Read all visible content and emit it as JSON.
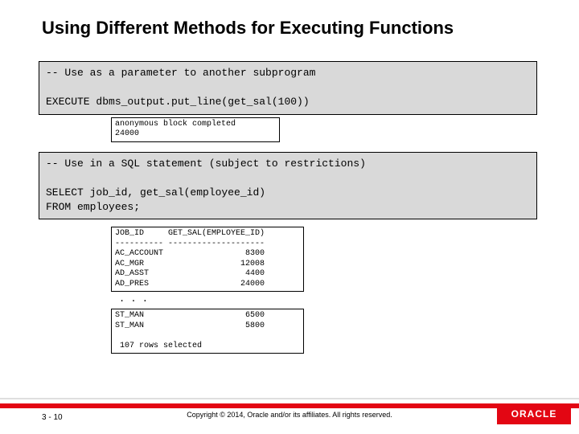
{
  "title": "Using Different Methods for Executing Functions",
  "code1": "-- Use as a parameter to another subprogram\n\nEXECUTE dbms_output.put_line(get_sal(100))",
  "output1": "anonymous block completed\n24000",
  "code2": "-- Use in a SQL statement (subject to restrictions)\n\nSELECT job_id, get_sal(employee_id)\nFROM employees;",
  "output2a": "JOB_ID     GET_SAL(EMPLOYEE_ID)\n---------- --------------------\nAC_ACCOUNT                 8300\nAC_MGR                    12008\nAD_ASST                    4400\nAD_PRES                   24000",
  "ellipsis": ". . .",
  "output2b": "ST_MAN                     6500\nST_MAN                     5800\n\n 107 rows selected",
  "footer": {
    "page": "3 - 10",
    "copyright": "Copyright © 2014, Oracle and/or its affiliates. All rights reserved.",
    "logo": "ORACLE"
  },
  "chart_data": {
    "type": "table",
    "title": "get_sal(employee_id) query result (visible rows)",
    "columns": [
      "JOB_ID",
      "GET_SAL(EMPLOYEE_ID)"
    ],
    "rows": [
      [
        "AC_ACCOUNT",
        8300
      ],
      [
        "AC_MGR",
        12008
      ],
      [
        "AD_ASST",
        4400
      ],
      [
        "AD_PRES",
        24000
      ],
      [
        "ST_MAN",
        6500
      ],
      [
        "ST_MAN",
        5800
      ]
    ],
    "total_rows": 107
  }
}
